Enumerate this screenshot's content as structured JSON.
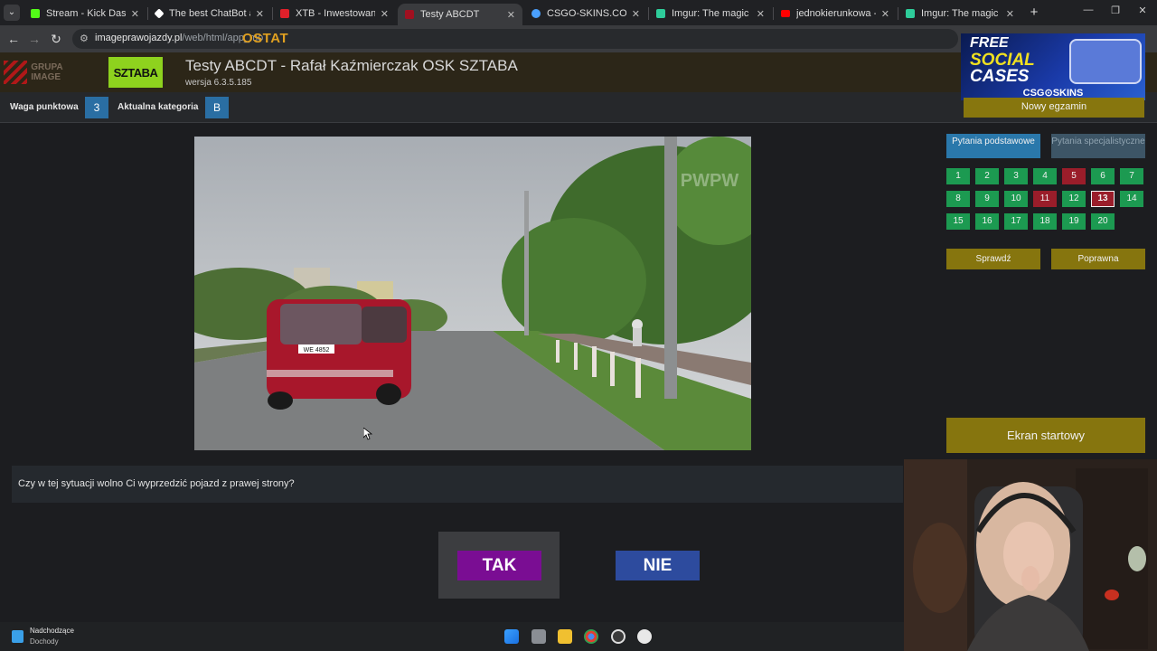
{
  "browser": {
    "tabs": [
      {
        "title": "Stream - Kick Dashboard",
        "icon": "kick-icon",
        "color": "#53fc18",
        "active": false
      },
      {
        "title": "The best ChatBot and Wi",
        "icon": "chatbot-icon",
        "color": "#ffffff",
        "active": false
      },
      {
        "title": "XTB - Inwestowanie, Oszc",
        "icon": "xtb-icon",
        "color": "#e0202a",
        "active": false
      },
      {
        "title": "Testy ABCDT",
        "icon": "testy-icon",
        "color": "#a01020",
        "active": true
      },
      {
        "title": "CSGO-SKINS.COM - Najle",
        "icon": "csgo-icon",
        "color": "#4aa0ff",
        "active": false
      },
      {
        "title": "Imgur: The magic of the I",
        "icon": "imgur-icon",
        "color": "#2ecc9a",
        "active": false
      },
      {
        "title": "jednokierunkowa - YouTu",
        "icon": "youtube-icon",
        "color": "#ff0000",
        "active": false
      },
      {
        "title": "Imgur: The magic of the I",
        "icon": "imgur-icon",
        "color": "#2ecc9a",
        "active": false
      }
    ],
    "new_tab": "+",
    "url_host": "imageprawojazdy.pl",
    "url_path": "/web/html/app_mo",
    "overlay_text": "OSTAT"
  },
  "header": {
    "grupa_logo": "GRUPA IMAGE",
    "sztaba_logo": "SZTABA",
    "title": "Testy ABCDT - Rafał Kaźmierczak OSK SZTABA",
    "version": "wersja 6.3.5.185"
  },
  "info": {
    "weight_label": "Waga punktowa",
    "weight_value": "3",
    "category_label": "Aktualna kategoria",
    "category_value": "B"
  },
  "video": {
    "plate": "WE 4852",
    "watermark": "PWPW"
  },
  "panel": {
    "new_exam": "Nowy egzamin",
    "tab_basic": "Pytania podstawowe",
    "tab_special": "Pytania specjalistyczne",
    "questions": [
      {
        "n": "1",
        "s": "ok"
      },
      {
        "n": "2",
        "s": "ok"
      },
      {
        "n": "3",
        "s": "ok"
      },
      {
        "n": "4",
        "s": "ok"
      },
      {
        "n": "5",
        "s": "bad"
      },
      {
        "n": "6",
        "s": "ok"
      },
      {
        "n": "7",
        "s": "ok"
      },
      {
        "n": "8",
        "s": "ok"
      },
      {
        "n": "9",
        "s": "ok"
      },
      {
        "n": "10",
        "s": "ok"
      },
      {
        "n": "11",
        "s": "bad"
      },
      {
        "n": "12",
        "s": "ok"
      },
      {
        "n": "13",
        "s": "cur"
      },
      {
        "n": "14",
        "s": "ok"
      },
      {
        "n": "15",
        "s": "ok"
      },
      {
        "n": "16",
        "s": "ok"
      },
      {
        "n": "17",
        "s": "ok"
      },
      {
        "n": "18",
        "s": "ok"
      },
      {
        "n": "19",
        "s": "ok"
      },
      {
        "n": "20",
        "s": "ok"
      }
    ],
    "check": "Sprawdź",
    "correct": "Poprawna",
    "start_screen": "Ekran startowy"
  },
  "ad": {
    "line1": "FREE",
    "line2": "SOCIAL",
    "line3": "CASES",
    "brand": "CSG⊙SKINS"
  },
  "question": {
    "text": "Czy w tej sytuacji wolno Ci wyprzedzić pojazd z prawej strony?",
    "yes": "TAK",
    "no": "NIE"
  },
  "taskbar": {
    "weather_title": "Nadchodzące",
    "weather_sub": "Dochody"
  },
  "colors": {
    "green": "#1c9a51",
    "red": "#9a1d2a",
    "gold": "#86750e",
    "blue": "#2a6ea3",
    "purple": "#7a0d93"
  }
}
